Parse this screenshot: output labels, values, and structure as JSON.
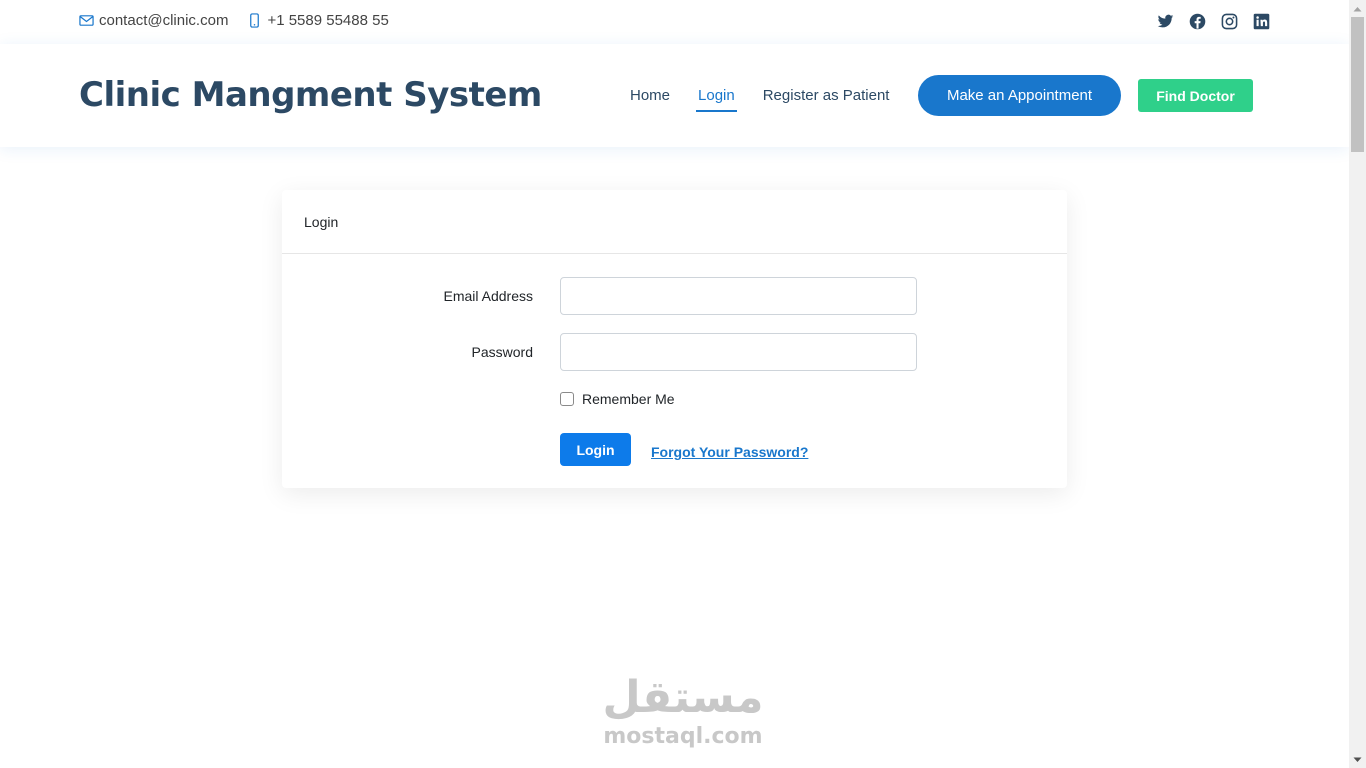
{
  "topbar": {
    "email": "contact@clinic.com",
    "phone": "+1 5589 55488 55",
    "email_icon": "envelope-icon",
    "phone_icon": "phone-icon",
    "social_icons": [
      "twitter-icon",
      "facebook-icon",
      "instagram-icon",
      "linkedin-icon"
    ]
  },
  "header": {
    "logo": "Clinic Mangment System",
    "nav": [
      {
        "label": "Home",
        "active": false
      },
      {
        "label": "Login",
        "active": true
      },
      {
        "label": "Register as Patient",
        "active": false
      }
    ],
    "appointment_button": "Make an Appointment",
    "find_doctor_button": "Find Doctor"
  },
  "login_card": {
    "title": "Login",
    "email_label": "Email Address",
    "email_value": "",
    "password_label": "Password",
    "password_value": "",
    "remember_label": "Remember Me",
    "remember_checked": false,
    "submit_label": "Login",
    "forgot_label": "Forgot Your Password?"
  },
  "watermark": {
    "arabic": "مستقل",
    "latin": "mostaql.com"
  },
  "colors": {
    "primary": "#1977cc",
    "heading": "#2c4964",
    "find_doctor": "#2fd08a",
    "login_button": "#0d7bea"
  }
}
